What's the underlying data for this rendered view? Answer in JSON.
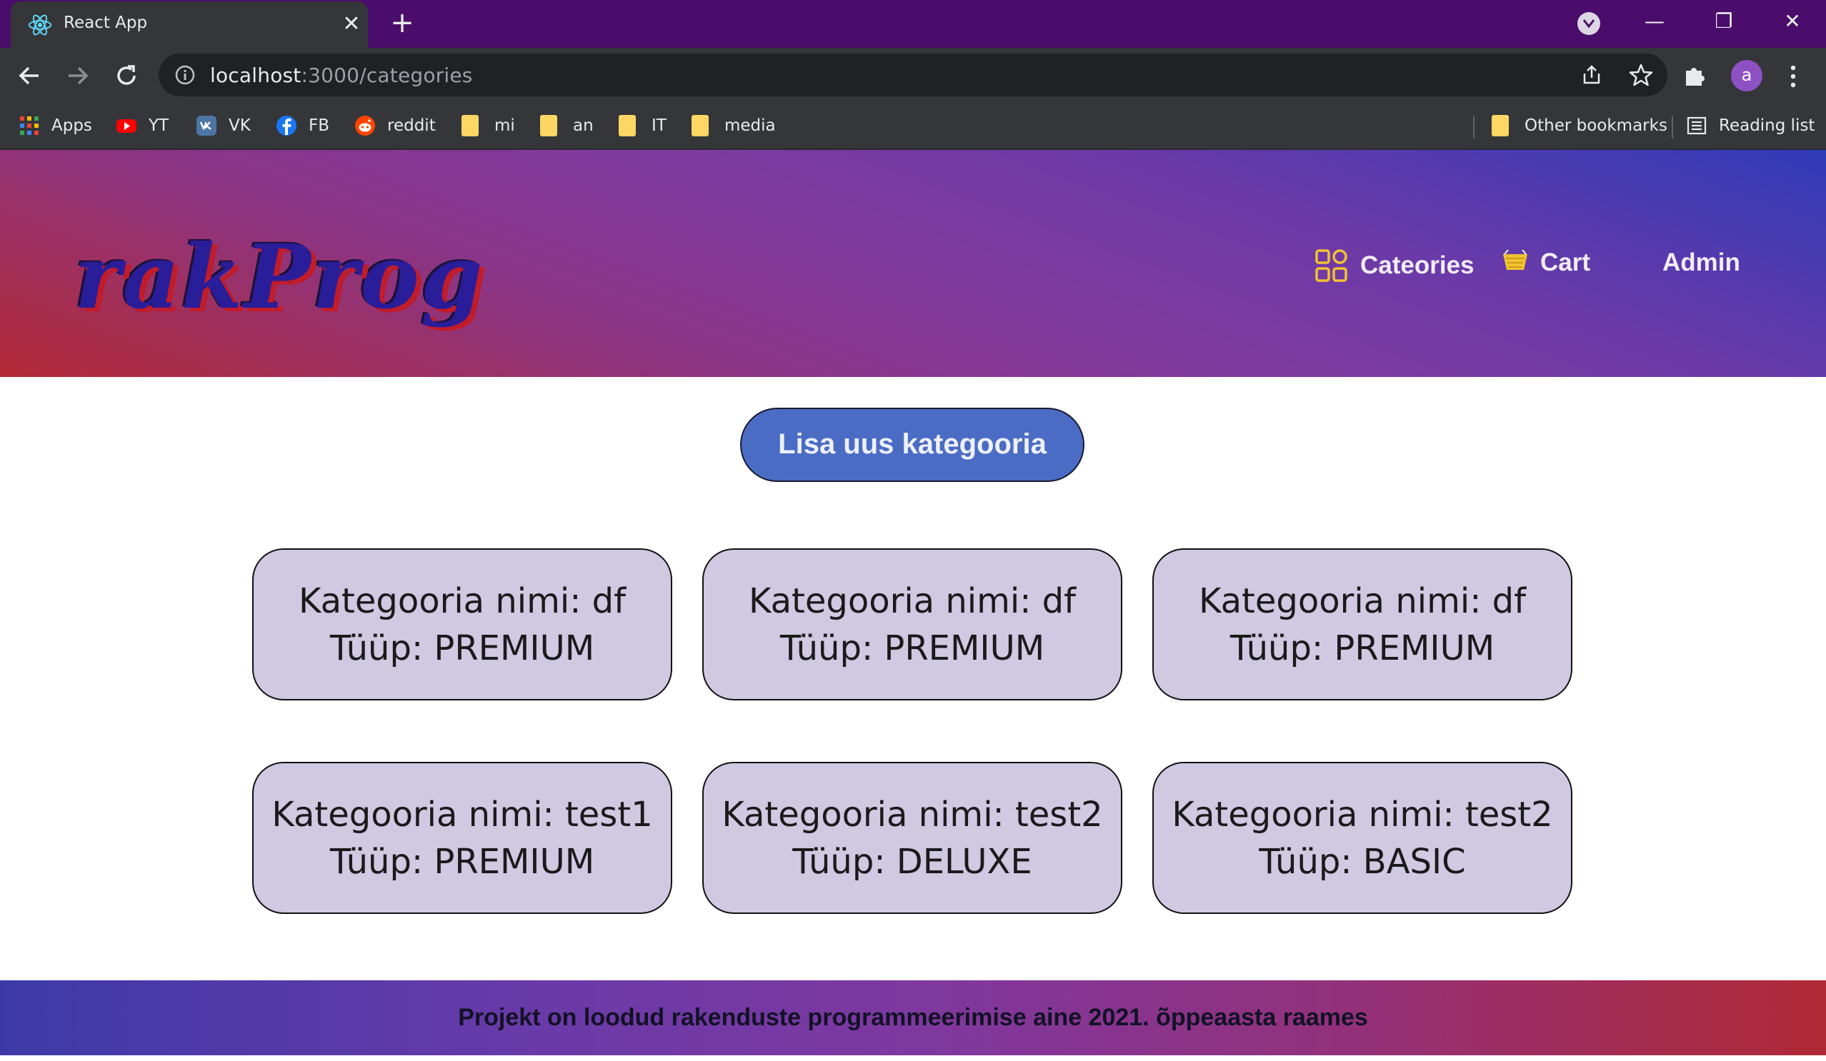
{
  "browser": {
    "tab_title": "React App",
    "close_symbol": "✕",
    "new_tab_symbol": "+",
    "window_controls": {
      "minimize": "—",
      "restore": "❐",
      "close": "✕"
    },
    "url_host": "localhost",
    "url_rest": ":3000/categories",
    "profile_initial": "a",
    "bookmarks": [
      {
        "label": "Apps",
        "icon": "apps-grid-icon"
      },
      {
        "label": "YT",
        "icon": "youtube-icon"
      },
      {
        "label": "VK",
        "icon": "vk-icon"
      },
      {
        "label": "FB",
        "icon": "facebook-icon"
      },
      {
        "label": "reddit",
        "icon": "reddit-icon"
      },
      {
        "label": "mi",
        "icon": "folder-icon"
      },
      {
        "label": "an",
        "icon": "folder-icon"
      },
      {
        "label": "IT",
        "icon": "folder-icon"
      },
      {
        "label": "media",
        "icon": "folder-icon"
      }
    ],
    "other_bookmarks": "Other bookmarks",
    "reading_list": "Reading list"
  },
  "header": {
    "logo": "rakProg",
    "nav": {
      "categories": "Cateories",
      "cart": "Cart",
      "admin": "Admin"
    }
  },
  "main": {
    "add_button": "Lisa uus kategooria",
    "categories": [
      {
        "name_line": "Kategooria nimi: df",
        "type_line": "Tüüp: PREMIUM"
      },
      {
        "name_line": "Kategooria nimi: df",
        "type_line": "Tüüp: PREMIUM"
      },
      {
        "name_line": "Kategooria nimi: df",
        "type_line": "Tüüp: PREMIUM"
      },
      {
        "name_line": "Kategooria nimi: test1",
        "type_line": "Tüüp: PREMIUM"
      },
      {
        "name_line": "Kategooria nimi: test2",
        "type_line": "Tüüp: DELUXE"
      },
      {
        "name_line": "Kategooria nimi: test2",
        "type_line": "Tüüp: BASIC"
      }
    ]
  },
  "footer": {
    "text": "Projekt on loodud rakenduste programmeerimise aine 2021. õppeaasta raames"
  },
  "colors": {
    "tabbar": "#4b0d6b",
    "chrome": "#35363a",
    "add_button": "#4a6cc4",
    "card": "#d1c8e2",
    "nav_icon_accent": "#f2c230"
  }
}
